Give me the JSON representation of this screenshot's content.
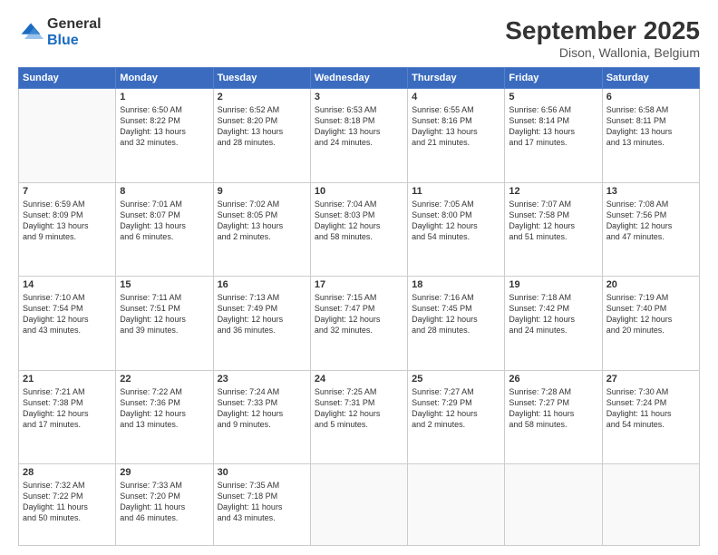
{
  "logo": {
    "general": "General",
    "blue": "Blue"
  },
  "header": {
    "title": "September 2025",
    "subtitle": "Dison, Wallonia, Belgium"
  },
  "weekdays": [
    "Sunday",
    "Monday",
    "Tuesday",
    "Wednesday",
    "Thursday",
    "Friday",
    "Saturday"
  ],
  "weeks": [
    [
      {
        "day": "",
        "info": ""
      },
      {
        "day": "1",
        "info": "Sunrise: 6:50 AM\nSunset: 8:22 PM\nDaylight: 13 hours\nand 32 minutes."
      },
      {
        "day": "2",
        "info": "Sunrise: 6:52 AM\nSunset: 8:20 PM\nDaylight: 13 hours\nand 28 minutes."
      },
      {
        "day": "3",
        "info": "Sunrise: 6:53 AM\nSunset: 8:18 PM\nDaylight: 13 hours\nand 24 minutes."
      },
      {
        "day": "4",
        "info": "Sunrise: 6:55 AM\nSunset: 8:16 PM\nDaylight: 13 hours\nand 21 minutes."
      },
      {
        "day": "5",
        "info": "Sunrise: 6:56 AM\nSunset: 8:14 PM\nDaylight: 13 hours\nand 17 minutes."
      },
      {
        "day": "6",
        "info": "Sunrise: 6:58 AM\nSunset: 8:11 PM\nDaylight: 13 hours\nand 13 minutes."
      }
    ],
    [
      {
        "day": "7",
        "info": "Sunrise: 6:59 AM\nSunset: 8:09 PM\nDaylight: 13 hours\nand 9 minutes."
      },
      {
        "day": "8",
        "info": "Sunrise: 7:01 AM\nSunset: 8:07 PM\nDaylight: 13 hours\nand 6 minutes."
      },
      {
        "day": "9",
        "info": "Sunrise: 7:02 AM\nSunset: 8:05 PM\nDaylight: 13 hours\nand 2 minutes."
      },
      {
        "day": "10",
        "info": "Sunrise: 7:04 AM\nSunset: 8:03 PM\nDaylight: 12 hours\nand 58 minutes."
      },
      {
        "day": "11",
        "info": "Sunrise: 7:05 AM\nSunset: 8:00 PM\nDaylight: 12 hours\nand 54 minutes."
      },
      {
        "day": "12",
        "info": "Sunrise: 7:07 AM\nSunset: 7:58 PM\nDaylight: 12 hours\nand 51 minutes."
      },
      {
        "day": "13",
        "info": "Sunrise: 7:08 AM\nSunset: 7:56 PM\nDaylight: 12 hours\nand 47 minutes."
      }
    ],
    [
      {
        "day": "14",
        "info": "Sunrise: 7:10 AM\nSunset: 7:54 PM\nDaylight: 12 hours\nand 43 minutes."
      },
      {
        "day": "15",
        "info": "Sunrise: 7:11 AM\nSunset: 7:51 PM\nDaylight: 12 hours\nand 39 minutes."
      },
      {
        "day": "16",
        "info": "Sunrise: 7:13 AM\nSunset: 7:49 PM\nDaylight: 12 hours\nand 36 minutes."
      },
      {
        "day": "17",
        "info": "Sunrise: 7:15 AM\nSunset: 7:47 PM\nDaylight: 12 hours\nand 32 minutes."
      },
      {
        "day": "18",
        "info": "Sunrise: 7:16 AM\nSunset: 7:45 PM\nDaylight: 12 hours\nand 28 minutes."
      },
      {
        "day": "19",
        "info": "Sunrise: 7:18 AM\nSunset: 7:42 PM\nDaylight: 12 hours\nand 24 minutes."
      },
      {
        "day": "20",
        "info": "Sunrise: 7:19 AM\nSunset: 7:40 PM\nDaylight: 12 hours\nand 20 minutes."
      }
    ],
    [
      {
        "day": "21",
        "info": "Sunrise: 7:21 AM\nSunset: 7:38 PM\nDaylight: 12 hours\nand 17 minutes."
      },
      {
        "day": "22",
        "info": "Sunrise: 7:22 AM\nSunset: 7:36 PM\nDaylight: 12 hours\nand 13 minutes."
      },
      {
        "day": "23",
        "info": "Sunrise: 7:24 AM\nSunset: 7:33 PM\nDaylight: 12 hours\nand 9 minutes."
      },
      {
        "day": "24",
        "info": "Sunrise: 7:25 AM\nSunset: 7:31 PM\nDaylight: 12 hours\nand 5 minutes."
      },
      {
        "day": "25",
        "info": "Sunrise: 7:27 AM\nSunset: 7:29 PM\nDaylight: 12 hours\nand 2 minutes."
      },
      {
        "day": "26",
        "info": "Sunrise: 7:28 AM\nSunset: 7:27 PM\nDaylight: 11 hours\nand 58 minutes."
      },
      {
        "day": "27",
        "info": "Sunrise: 7:30 AM\nSunset: 7:24 PM\nDaylight: 11 hours\nand 54 minutes."
      }
    ],
    [
      {
        "day": "28",
        "info": "Sunrise: 7:32 AM\nSunset: 7:22 PM\nDaylight: 11 hours\nand 50 minutes."
      },
      {
        "day": "29",
        "info": "Sunrise: 7:33 AM\nSunset: 7:20 PM\nDaylight: 11 hours\nand 46 minutes."
      },
      {
        "day": "30",
        "info": "Sunrise: 7:35 AM\nSunset: 7:18 PM\nDaylight: 11 hours\nand 43 minutes."
      },
      {
        "day": "",
        "info": ""
      },
      {
        "day": "",
        "info": ""
      },
      {
        "day": "",
        "info": ""
      },
      {
        "day": "",
        "info": ""
      }
    ]
  ]
}
